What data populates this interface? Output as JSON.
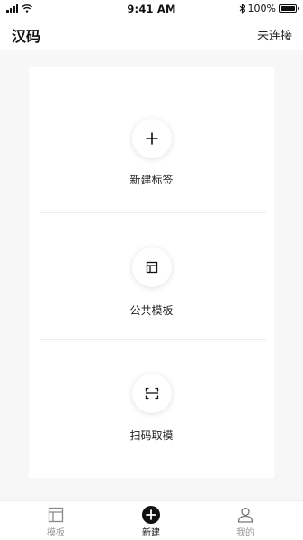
{
  "status_bar": {
    "time": "9:41 AM",
    "battery": "100%",
    "battery_level": 1.0
  },
  "nav": {
    "title": "汉码",
    "connection_status": "未连接"
  },
  "actions": [
    {
      "label": "新建标签",
      "icon": "plus-icon"
    },
    {
      "label": "公共模板",
      "icon": "template-icon"
    },
    {
      "label": "扫码取模",
      "icon": "scan-icon"
    }
  ],
  "tabs": [
    {
      "label": "模板",
      "icon": "template-tab-icon",
      "active": false
    },
    {
      "label": "新建",
      "icon": "add-circle-icon",
      "active": true
    },
    {
      "label": "我的",
      "icon": "user-icon",
      "active": false
    }
  ]
}
